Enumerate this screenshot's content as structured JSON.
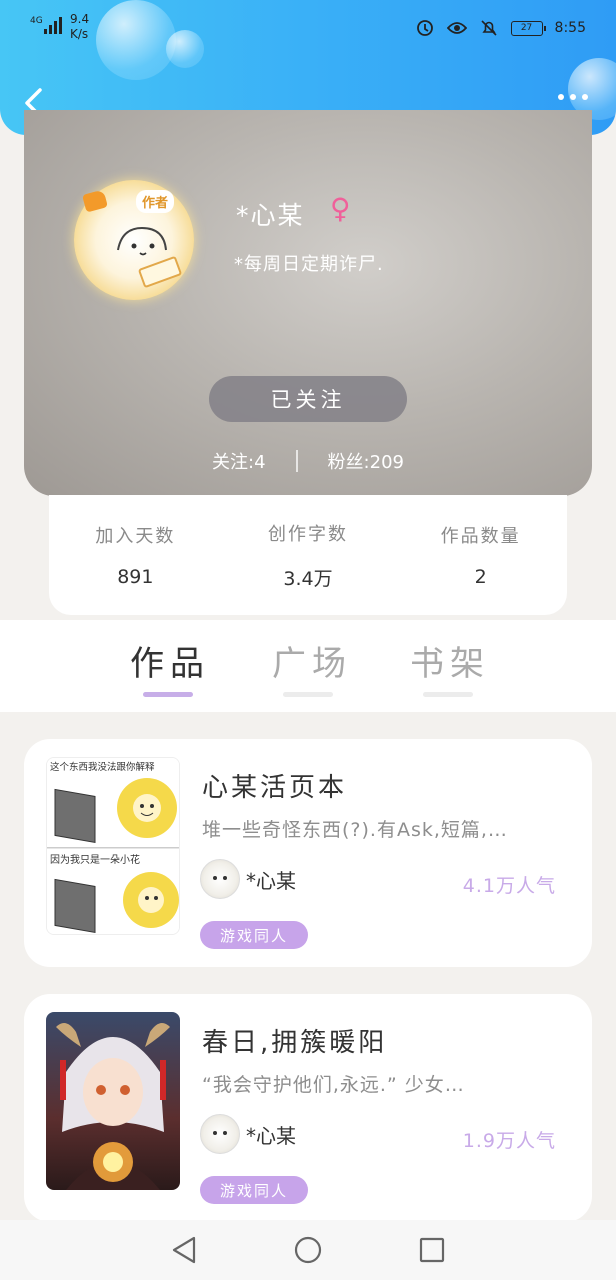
{
  "status_bar": {
    "signal": "4G",
    "net_speed_value": "9.4",
    "net_speed_unit": "K/s",
    "battery": "27",
    "time": "8:55"
  },
  "header": {
    "back_icon": "chevron-left-icon",
    "more_icon": "more-horizontal-icon",
    "color": "#3ab0f7"
  },
  "profile": {
    "author_tag": "作者",
    "name": "*心某",
    "gender_symbol": "♀",
    "signature": "*每周日定期诈尸.",
    "follow_button": "已关注",
    "following_label": "关注:4",
    "fans_label": "粉丝:209"
  },
  "stats": [
    {
      "label": "加入天数",
      "value": "891"
    },
    {
      "label": "创作字数",
      "value": "3.4万"
    },
    {
      "label": "作品数量",
      "value": "2"
    }
  ],
  "tabs": [
    {
      "label": "作品",
      "active": true
    },
    {
      "label": "广场",
      "active": false
    },
    {
      "label": "书架",
      "active": false
    }
  ],
  "works": [
    {
      "title": "心某活页本",
      "description": "堆一些奇怪东西(?).有Ask,短篇,…",
      "author": "*心某",
      "popularity": "4.1万人气",
      "tag": "游戏同人",
      "cover_text_top": "这个东西我没法跟你解释",
      "cover_text_bottom": "因为我只是一朵小花"
    },
    {
      "title": "春日,拥簇暖阳",
      "description": "“我会守护他们,永远.” 少女…",
      "author": "*心某",
      "popularity": "1.9万人气",
      "tag": "游戏同人"
    }
  ],
  "colors": {
    "accent_purple": "#c7a4ea",
    "gender_pink": "#f0609a",
    "popularity": "#c8aae8"
  }
}
